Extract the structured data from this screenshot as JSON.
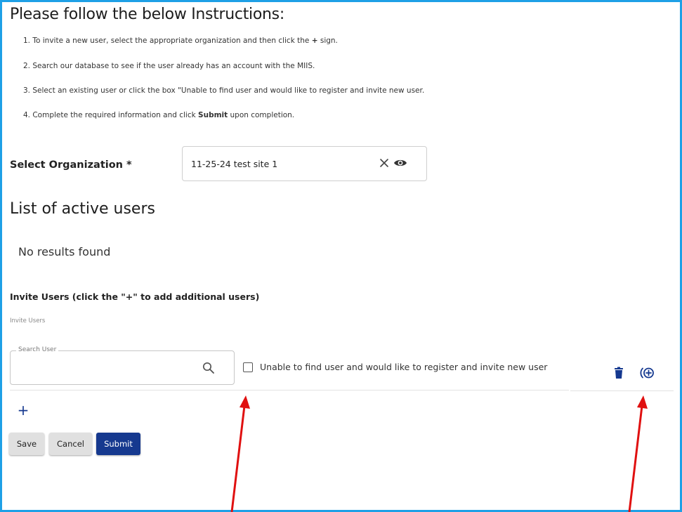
{
  "instructions": {
    "heading": "Please follow the below Instructions:",
    "step1_pre": "1. To invite a new user, select the appropriate organization and then click the ",
    "step1_bold": "+",
    "step1_post": " sign.",
    "step2": "2. Search our database to see if the user already has an account with the MIIS.",
    "step3": "3. Select an existing user or click the box \"Unable to find user and would like to register and invite new user.",
    "step4_pre": "4. Complete the required information and click ",
    "step4_bold": "Submit",
    "step4_post": " upon completion."
  },
  "organization": {
    "label": "Select Organization *",
    "value": "11-25-24 test site 1",
    "clear_icon": "close-icon",
    "view_icon": "eye-icon"
  },
  "active_users": {
    "title": "List of active users",
    "empty_text": "No results found"
  },
  "invite": {
    "title": "Invite Users (click the \"+\" to add additional users)",
    "subtitle": "Invite Users",
    "search_legend": "Search User",
    "search_value": "",
    "checkbox_label": "Unable to find user and would like to register and invite new user",
    "checkbox_checked": false,
    "add_row_symbol": "+"
  },
  "buttons": {
    "save": "Save",
    "cancel": "Cancel",
    "submit": "Submit"
  },
  "colors": {
    "frame_border": "#1ea0e6",
    "primary": "#16398f",
    "icon_blue": "#14388f",
    "annotation_arrow": "#e01010"
  }
}
